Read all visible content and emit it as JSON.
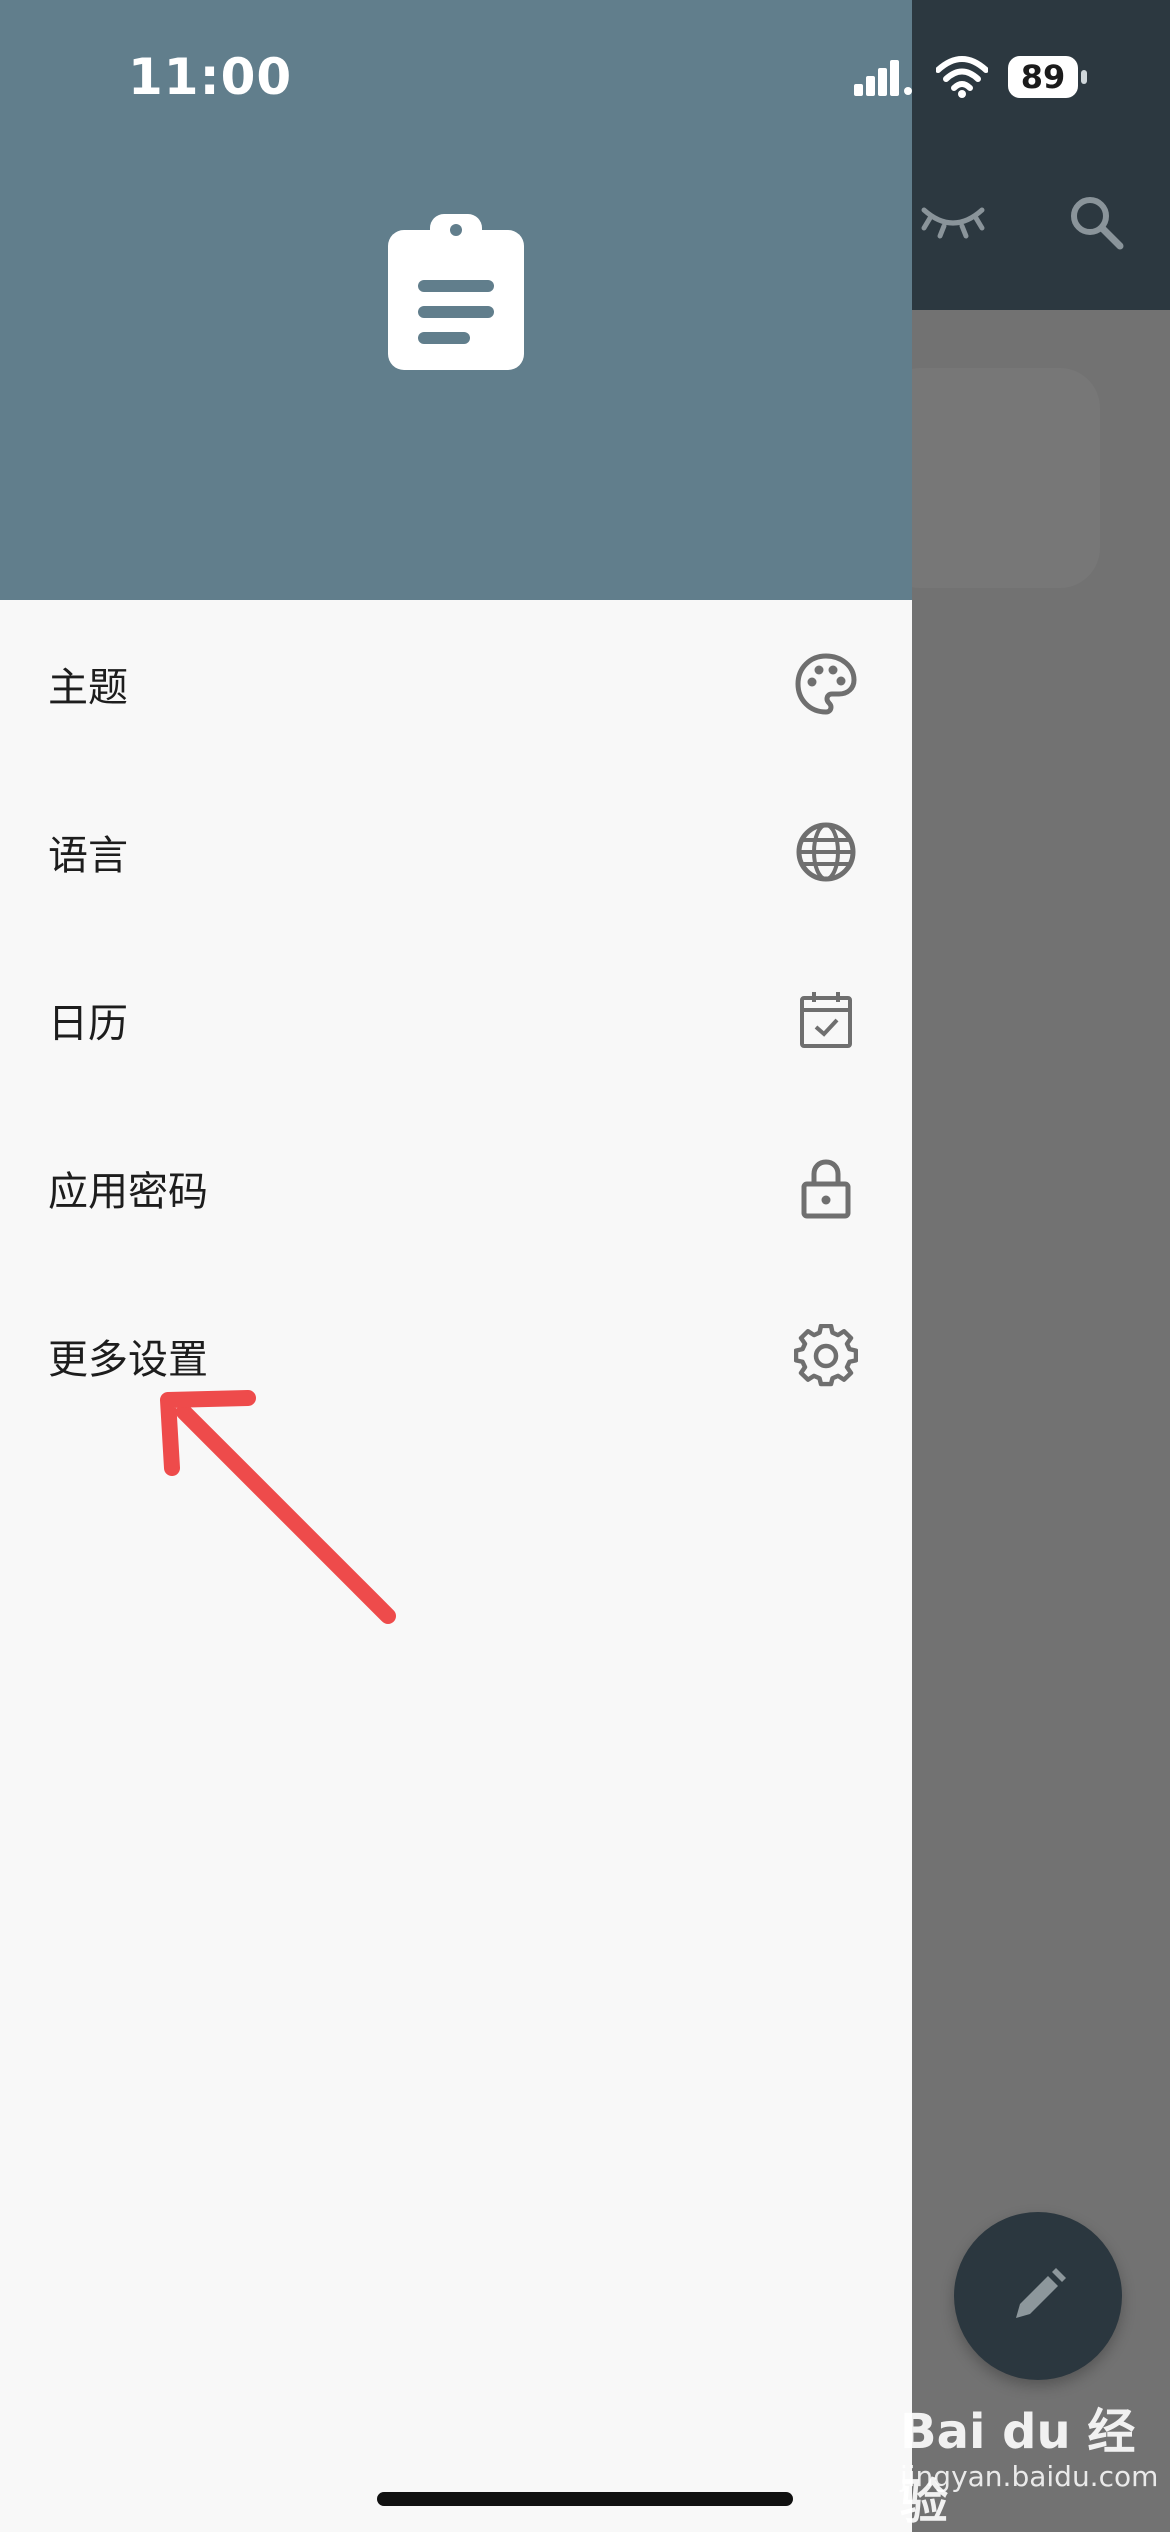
{
  "status_bar": {
    "time": "11:00",
    "battery": "89"
  },
  "drawer": {
    "items": [
      {
        "label": "主题",
        "icon": "palette-icon"
      },
      {
        "label": "语言",
        "icon": "globe-icon"
      },
      {
        "label": "日历",
        "icon": "calendar-check-icon"
      },
      {
        "label": "应用密码",
        "icon": "lock-icon"
      },
      {
        "label": "更多设置",
        "icon": "gear-icon"
      }
    ]
  },
  "watermark": {
    "brand": "Bai du 经验",
    "url": "jingyan.baidu.com"
  },
  "colors": {
    "drawer_header": "#617e8c",
    "app_bar": "#2c3840",
    "annotation": "#ee4b4b",
    "fab": "#2b373f"
  }
}
